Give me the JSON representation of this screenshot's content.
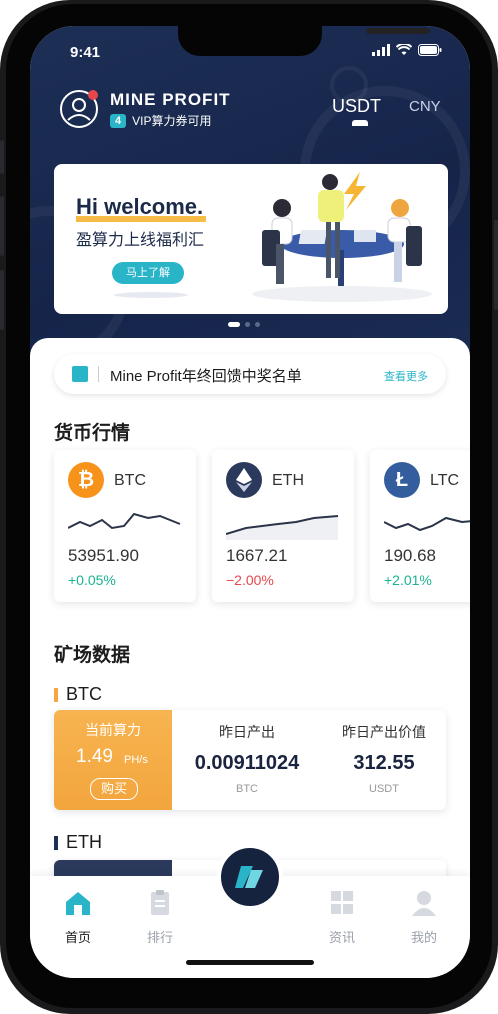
{
  "status": {
    "time": "9:41"
  },
  "header": {
    "brand": "MINE PROFIT",
    "vip_count": "4",
    "vip_text": "VIP算力券可用",
    "currencies": {
      "active": "USDT",
      "inactive": "CNY"
    }
  },
  "banner": {
    "headline": "Hi welcome.",
    "subtitle": "盈算力上线福利汇",
    "button": "马上了解"
  },
  "notice": {
    "text": "Mine Profit年终回馈中奖名单",
    "more": "查看更多"
  },
  "market": {
    "title": "货币行情",
    "coins": [
      {
        "symbol": "BTC",
        "price": "53951.90",
        "change": "+0.05%",
        "trend": "up"
      },
      {
        "symbol": "ETH",
        "price": "1667.21",
        "change": "−2.00%",
        "trend": "down"
      },
      {
        "symbol": "LTC",
        "price": "190.68",
        "change": "+2.01%",
        "trend": "up"
      }
    ]
  },
  "mining": {
    "title": "矿场数据",
    "btc": {
      "label": "BTC",
      "hash_title": "当前算力",
      "hash_value": "1.49",
      "hash_unit": "PH/s",
      "buy": "购买",
      "col1_title": "昨日产出",
      "col1_value": "0.00911024",
      "col1_unit": "BTC",
      "col2_title": "昨日产出价值",
      "col2_value": "312.55",
      "col2_unit": "USDT"
    },
    "eth": {
      "label": "ETH"
    }
  },
  "tabbar": {
    "items": [
      {
        "label": "首页",
        "active": true
      },
      {
        "label": "排行",
        "active": false
      },
      {
        "label": "资讯",
        "active": false
      },
      {
        "label": "我的",
        "active": false
      }
    ]
  },
  "colors": {
    "accent": "#2ab4c8",
    "navy": "#1d2f55",
    "orange": "#f6a542",
    "up": "#1ab394",
    "down": "#e8464b",
    "btc": "#f7931a",
    "eth": "#2b3a5c",
    "ltc": "#345d9d"
  }
}
